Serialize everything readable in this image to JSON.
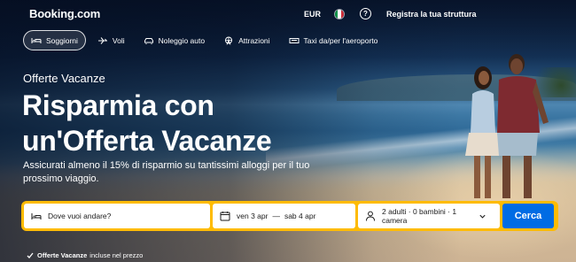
{
  "header": {
    "logo": "Booking.com",
    "currency": "EUR",
    "flag_colors": [
      "#009246",
      "#ffffff",
      "#ce2b37"
    ],
    "help_symbol": "?",
    "register_label": "Registra la tua struttura"
  },
  "nav": {
    "items": [
      {
        "label": "Soggiorni",
        "icon": "bed-icon",
        "active": true
      },
      {
        "label": "Voli",
        "icon": "plane-icon",
        "active": false
      },
      {
        "label": "Noleggio auto",
        "icon": "car-icon",
        "active": false
      },
      {
        "label": "Attrazioni",
        "icon": "ferris-wheel-icon",
        "active": false
      },
      {
        "label": "Taxi da/per l'aeroporto",
        "icon": "taxi-icon",
        "active": false
      }
    ]
  },
  "hero": {
    "eyebrow": "Offerte Vacanze",
    "headline_line1": "Risparmia con",
    "headline_line2": "un'Offerta Vacanze",
    "subtitle": "Assicurati almeno il 15% di risparmio su tantissimi alloggi per il tuo prossimo viaggio."
  },
  "search": {
    "destination_placeholder": "Dove vuoi andare?",
    "checkin": "ven 3 apr",
    "date_separator": "—",
    "checkout": "sab 4 apr",
    "guests": "2 adulti · 0 bambini · 1 camera",
    "submit_label": "Cerca",
    "border_color": "#febb02",
    "button_color": "#006ce4"
  },
  "footnote": {
    "bold": "Offerte Vacanze",
    "text": "incluse nel prezzo"
  }
}
